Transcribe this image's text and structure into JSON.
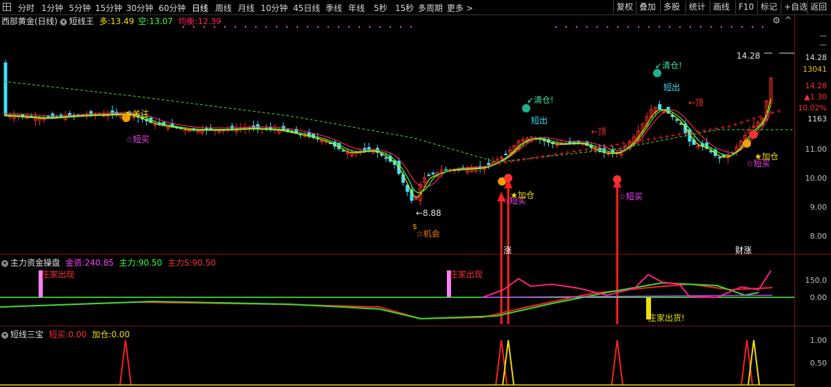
{
  "toolbar": {
    "periods": [
      "分时",
      "1分钟",
      "5分钟",
      "15分钟",
      "30分钟",
      "60分钟",
      "日线",
      "周线",
      "月线",
      "10分钟",
      "45日线",
      "季线",
      "年线",
      "5秒",
      "15秒",
      "多周期",
      "更多 >"
    ],
    "active_period": "日线",
    "right_buttons": [
      "复权",
      "叠加",
      "多股",
      "统计",
      "画线",
      "F10",
      "标记",
      "+自选",
      "返回"
    ]
  },
  "main_panel": {
    "stock_name": "西部黄金(日线)",
    "indicator": "短线王",
    "duo_label": "多:",
    "duo_value": "13.49",
    "kong_label": "空:",
    "kong_value": "13.07",
    "junheng_label": "均衡:",
    "junheng_value": "12.39",
    "y_ticks": [
      "11.00",
      "10.00",
      "9.00",
      "8.00"
    ],
    "right_info": [
      "14.28",
      "13041",
      "14.28",
      "▲1.30",
      "10.02%",
      "1163"
    ],
    "right_info_colors": [
      "#e0e0e0",
      "#f0c000",
      "#ff3030",
      "#ff3030",
      "#ff3030",
      "#e0e0e0"
    ],
    "annotations": [
      {
        "text": "↖关注",
        "color": "#f0e000"
      },
      {
        "text": "☆短买",
        "color": "#ff40ff"
      },
      {
        "text": "←8.88",
        "color": "#e0e0e0"
      },
      {
        "text": "☆机会",
        "color": "#ff8000"
      },
      {
        "text": "☆短买",
        "color": "#ff40ff"
      },
      {
        "text": "★加仓",
        "color": "#f0e000"
      },
      {
        "text": "↙清仓!",
        "color": "#40e0a0"
      },
      {
        "text": "短出",
        "color": "#40e0ff"
      },
      {
        "text": "←顶",
        "color": "#ff3030"
      },
      {
        "text": "☆短买",
        "color": "#ff40ff"
      },
      {
        "text": "↙清仓!",
        "color": "#40e0a0"
      },
      {
        "text": "短出",
        "color": "#40e0ff"
      },
      {
        "text": "←顶",
        "color": "#ff3030"
      },
      {
        "text": "★加仓",
        "color": "#f0e000"
      },
      {
        "text": "☆短买",
        "color": "#ff40ff"
      },
      {
        "text": "14.28",
        "color": "#e0e0e0"
      },
      {
        "text": "涨",
        "color": "#ffffff"
      },
      {
        "text": "财涨",
        "color": "#ffffff"
      }
    ]
  },
  "fund_panel": {
    "name": "主力资金操盘",
    "jinzi_label": "金资:",
    "jinzi_value": "240.85",
    "zhuli_label": "主力:",
    "zhuli_value": "90.50",
    "zhulis_label": "主力S:",
    "zhulis_value": "90.50",
    "y_ticks": [
      "150.0",
      "0.00"
    ],
    "annotations": [
      "庄家出现",
      "庄家出现",
      "庄家出货!"
    ]
  },
  "sanbao_panel": {
    "name": "短线三宝",
    "duanmai_label": "短买:",
    "duanmai_value": "0.00",
    "jiacang_label": "加仓:",
    "jiacang_value": "0.00",
    "y_ticks": [
      "1.00",
      "0.50"
    ]
  },
  "colors": {
    "up": "#ff3030",
    "down": "#40e0ff",
    "ma_red": "#ff2060",
    "ma_yellow": "#f0e000",
    "ma_green": "#40ff40",
    "dash_green": "#30c030",
    "cross": "#ff2020"
  }
}
